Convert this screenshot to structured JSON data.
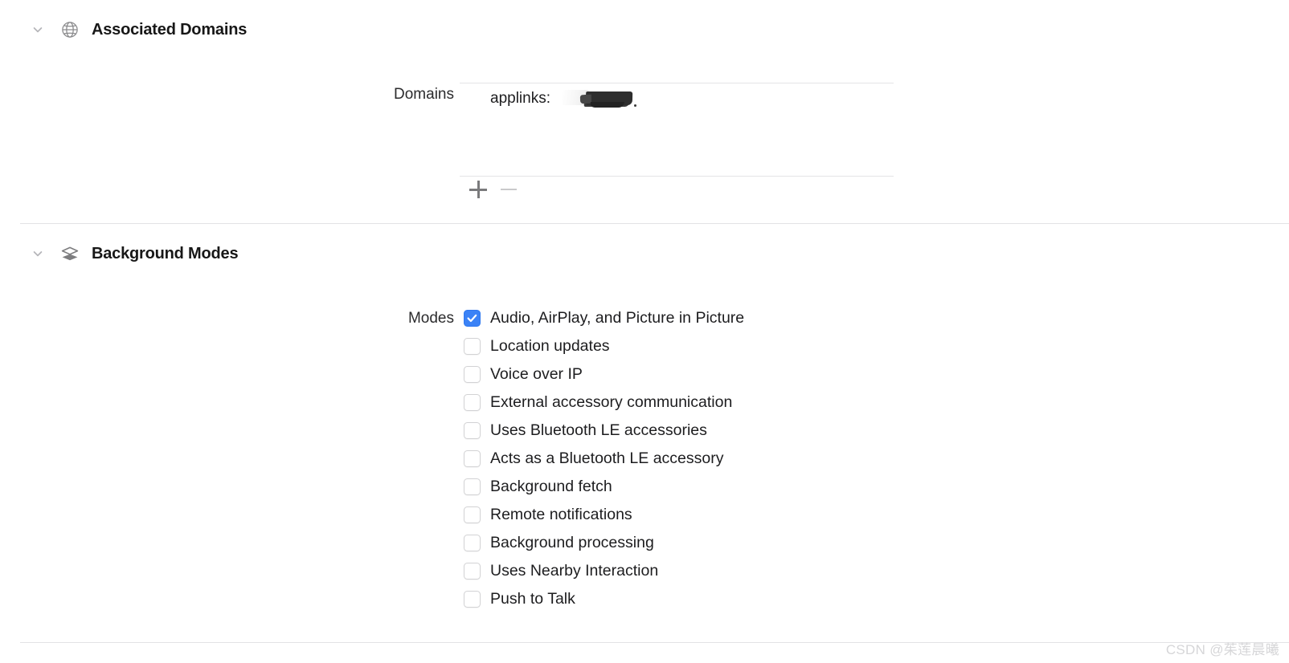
{
  "sections": [
    {
      "id": "associated-domains",
      "title": "Associated Domains",
      "icon": "globe-icon",
      "expanded": true,
      "field_label": "Domains",
      "entries": [
        {
          "prefix": "applinks:",
          "value_redacted": true
        }
      ],
      "add_button": "+",
      "remove_button": "−"
    },
    {
      "id": "background-modes",
      "title": "Background Modes",
      "icon": "layers-icon",
      "expanded": true,
      "field_label": "Modes",
      "modes": [
        {
          "label": "Audio, AirPlay, and Picture in Picture",
          "checked": true
        },
        {
          "label": "Location updates",
          "checked": false
        },
        {
          "label": "Voice over IP",
          "checked": false
        },
        {
          "label": "External accessory communication",
          "checked": false
        },
        {
          "label": "Uses Bluetooth LE accessories",
          "checked": false
        },
        {
          "label": "Acts as a Bluetooth LE accessory",
          "checked": false
        },
        {
          "label": "Background fetch",
          "checked": false
        },
        {
          "label": "Remote notifications",
          "checked": false
        },
        {
          "label": "Background processing",
          "checked": false
        },
        {
          "label": "Uses Nearby Interaction",
          "checked": false
        },
        {
          "label": "Push to Talk",
          "checked": false
        }
      ]
    }
  ],
  "watermark": "CSDN @茱莲晨曦",
  "colors": {
    "checkbox_checked": "#3b82f6",
    "divider": "#e3e3e5",
    "icon_gray": "#8a8a8c",
    "text": "#1d1d1f",
    "watermark": "#d6d6d8"
  }
}
